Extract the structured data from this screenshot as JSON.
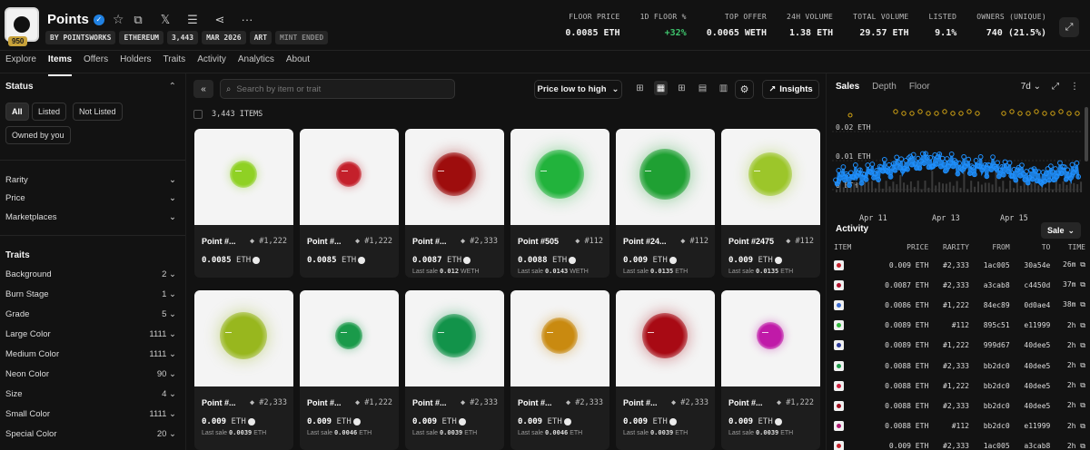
{
  "collection": {
    "name": "Points",
    "badge": "950",
    "tags": [
      "BY POINTSWORKS",
      "ETHEREUM",
      "3,443",
      "MAR 2026",
      "ART",
      "MINT ENDED"
    ]
  },
  "stats": [
    {
      "label": "FLOOR PRICE",
      "value": "0.0085 ETH"
    },
    {
      "label": "1D FLOOR %",
      "value": "+32%",
      "color": "#3ec46d"
    },
    {
      "label": "TOP OFFER",
      "value": "0.0065 WETH"
    },
    {
      "label": "24H VOLUME",
      "value": "1.38 ETH"
    },
    {
      "label": "TOTAL VOLUME",
      "value": "29.57 ETH"
    },
    {
      "label": "LISTED",
      "value": "9.1%"
    },
    {
      "label": "OWNERS (UNIQUE)",
      "value": "740 (21.5%)"
    }
  ],
  "tabs": [
    "Explore",
    "Items",
    "Offers",
    "Holders",
    "Traits",
    "Activity",
    "Analytics",
    "About"
  ],
  "active_tab": "Items",
  "sidebar": {
    "status_title": "Status",
    "status_pills": [
      "All",
      "Listed",
      "Not Listed",
      "Owned by you"
    ],
    "filters": [
      "Rarity",
      "Price",
      "Marketplaces"
    ],
    "traits_title": "Traits",
    "traits": [
      {
        "name": "Background",
        "count": "2"
      },
      {
        "name": "Burn Stage",
        "count": "1"
      },
      {
        "name": "Grade",
        "count": "5"
      },
      {
        "name": "Large Color",
        "count": "1111"
      },
      {
        "name": "Medium Color",
        "count": "1111"
      },
      {
        "name": "Neon Color",
        "count": "90"
      },
      {
        "name": "Size",
        "count": "4"
      },
      {
        "name": "Small Color",
        "count": "1111"
      },
      {
        "name": "Special Color",
        "count": "20"
      }
    ]
  },
  "toolbar": {
    "search_placeholder": "Search by item or trait",
    "sort": "Price low to high",
    "insights": "Insights",
    "item_count": "3,443 ITEMS"
  },
  "items": [
    {
      "name": "Point #...",
      "rarity": "#1,222",
      "price": "0.0085",
      "unit": "ETH",
      "last_sale": "",
      "color": "#8fd124",
      "size": 30
    },
    {
      "name": "Point #...",
      "rarity": "#1,222",
      "price": "0.0085",
      "unit": "ETH",
      "last_sale": "",
      "color": "#c4202b",
      "size": 28
    },
    {
      "name": "Point #...",
      "rarity": "#2,333",
      "price": "0.0087",
      "unit": "ETH",
      "last_sale": "0.012",
      "last_unit": "WETH",
      "color": "#9e0d0d",
      "size": 48
    },
    {
      "name": "Point #505",
      "rarity": "#112",
      "price": "0.0088",
      "unit": "ETH",
      "last_sale": "0.0143",
      "last_unit": "WETH",
      "color": "#22b33c",
      "size": 54
    },
    {
      "name": "Point #24...",
      "rarity": "#112",
      "price": "0.009",
      "unit": "ETH",
      "last_sale": "0.0135",
      "last_unit": "ETH",
      "color": "#1fa033",
      "size": 56
    },
    {
      "name": "Point #2475",
      "rarity": "#112",
      "price": "0.009",
      "unit": "ETH",
      "last_sale": "0.0135",
      "last_unit": "ETH",
      "color": "#9cc62a",
      "size": 48
    },
    {
      "name": "Point #...",
      "rarity": "#2,333",
      "price": "0.009",
      "unit": "ETH",
      "last_sale": "0.0039",
      "last_unit": "ETH",
      "color": "#98b71e",
      "size": 52
    },
    {
      "name": "Point #...",
      "rarity": "#1,222",
      "price": "0.009",
      "unit": "ETH",
      "last_sale": "0.0046",
      "last_unit": "ETH",
      "color": "#1a9a4a",
      "size": 30
    },
    {
      "name": "Point #...",
      "rarity": "#2,333",
      "price": "0.009",
      "unit": "ETH",
      "last_sale": "0.0039",
      "last_unit": "ETH",
      "color": "#12934a",
      "size": 48
    },
    {
      "name": "Point #...",
      "rarity": "#2,333",
      "price": "0.009",
      "unit": "ETH",
      "last_sale": "0.0046",
      "last_unit": "ETH",
      "color": "#c98a10",
      "size": 40
    },
    {
      "name": "Point #...",
      "rarity": "#2,333",
      "price": "0.009",
      "unit": "ETH",
      "last_sale": "0.0039",
      "last_unit": "ETH",
      "color": "#a80a14",
      "size": 50
    },
    {
      "name": "Point #...",
      "rarity": "#1,222",
      "price": "0.009",
      "unit": "ETH",
      "last_sale": "0.0039",
      "last_unit": "ETH",
      "color": "#c01aa8",
      "size": 30
    }
  ],
  "right_panel": {
    "tabs": [
      "Sales",
      "Depth",
      "Floor"
    ],
    "active": "Sales",
    "range": "7d",
    "activity_title": "Activity",
    "activity_filter": "Sale",
    "columns": [
      "ITEM",
      "PRICE",
      "RARITY",
      "FROM",
      "TO",
      "TIME"
    ],
    "rows": [
      {
        "color": "#c4202b",
        "price": "0.009 ETH",
        "rarity": "#2,333",
        "from": "1ac005",
        "to": "30a54e",
        "time": "26m"
      },
      {
        "color": "#b0102a",
        "price": "0.0087 ETH",
        "rarity": "#2,333",
        "from": "a3cab8",
        "to": "c4450d",
        "time": "37m"
      },
      {
        "color": "#3a6ad0",
        "price": "0.0086 ETH",
        "rarity": "#1,222",
        "from": "84ec89",
        "to": "0d0ae4",
        "time": "38m"
      },
      {
        "color": "#2fb83a",
        "price": "0.0089 ETH",
        "rarity": "#112",
        "from": "895c51",
        "to": "e11999",
        "time": "2h"
      },
      {
        "color": "#2b3a9a",
        "price": "0.0089 ETH",
        "rarity": "#1,222",
        "from": "999d67",
        "to": "40dee5",
        "time": "2h"
      },
      {
        "color": "#1aa04a",
        "price": "0.0088 ETH",
        "rarity": "#2,333",
        "from": "bb2dc0",
        "to": "40dee5",
        "time": "2h"
      },
      {
        "color": "#d02040",
        "price": "0.0088 ETH",
        "rarity": "#1,222",
        "from": "bb2dc0",
        "to": "40dee5",
        "time": "2h"
      },
      {
        "color": "#a01020",
        "price": "0.0088 ETH",
        "rarity": "#2,333",
        "from": "bb2dc0",
        "to": "40dee5",
        "time": "2h"
      },
      {
        "color": "#b01a70",
        "price": "0.0088 ETH",
        "rarity": "#112",
        "from": "bb2dc0",
        "to": "e11999",
        "time": "2h"
      },
      {
        "color": "#c4202b",
        "price": "0.009 ETH",
        "rarity": "#2,333",
        "from": "1ac005",
        "to": "a3cab8",
        "time": "2h"
      }
    ]
  },
  "chart_data": {
    "type": "scatter",
    "x_ticks": [
      "Apr 11",
      "Apr 13",
      "Apr 15"
    ],
    "y_ticks": [
      "0.02 ETH",
      "0.01 ETH",
      "0 ETH"
    ],
    "ylim": [
      0,
      0.028
    ],
    "series_color": "#1e90ff",
    "offer_color": "#d4a514"
  }
}
